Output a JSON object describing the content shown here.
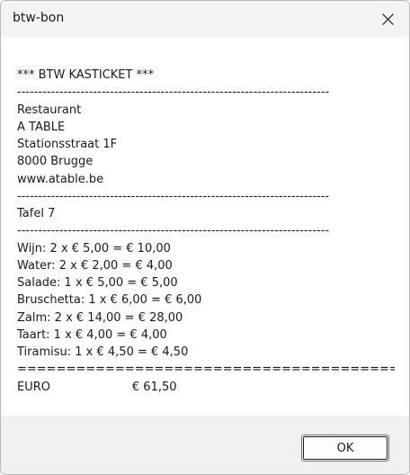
{
  "window": {
    "title": "btw-bon",
    "close_icon": "close-icon"
  },
  "receipt": {
    "lines": [
      "*** BTW KASTICKET ***",
      "--------------------------------------------------------------------------",
      "Restaurant",
      "A TABLE",
      "Stationsstraat 1F",
      "8000 Brugge",
      "www.atable.be",
      "--------------------------------------------------------------------------",
      "Tafel 7",
      "--------------------------------------------------------------------------",
      "Wijn: 2 x € 5,00 = € 10,00",
      "Water: 2 x € 2,00 = € 4,00",
      "Salade: 1 x € 5,00 = € 5,00",
      "Bruschetta: 1 x € 6,00 = € 6,00",
      "Zalm: 2 x € 14,00 = € 28,00",
      "Taart: 1 x € 4,00 = € 4,00",
      "Tiramisu: 1 x € 4,50 = € 4,50",
      "=======================================",
      "EURO                      € 61,50"
    ]
  },
  "footer": {
    "ok_label": "OK"
  }
}
